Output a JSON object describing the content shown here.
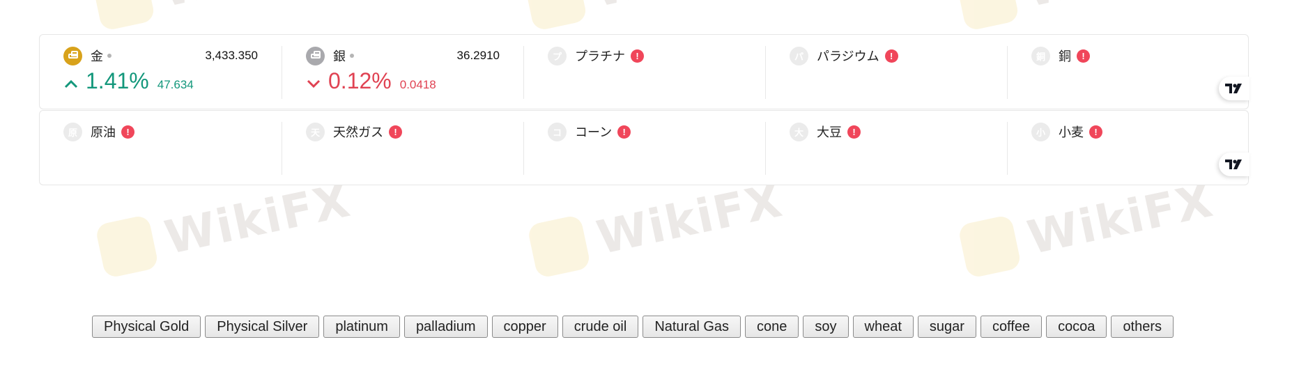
{
  "watermark": {
    "text": "WikiFX"
  },
  "tickers_row1": [
    {
      "symbol": "gold",
      "name": "金",
      "price": "3,433.350",
      "change_pct": "1.41%",
      "change_abs": "47.634",
      "direction": "up",
      "icon": "gold-bar-icon"
    },
    {
      "symbol": "silver",
      "name": "銀",
      "price": "36.2910",
      "change_pct": "0.12%",
      "change_abs": "0.0418",
      "direction": "down",
      "icon": "silver-bar-icon"
    },
    {
      "symbol": "platinum",
      "name": "プラチナ",
      "glyph": "プ",
      "status": "error"
    },
    {
      "symbol": "palladium",
      "name": "パラジウム",
      "glyph": "パ",
      "status": "error"
    },
    {
      "symbol": "copper",
      "name": "銅",
      "glyph": "銅",
      "status": "error"
    }
  ],
  "tickers_row2": [
    {
      "symbol": "crude-oil",
      "name": "原油",
      "glyph": "原",
      "status": "error"
    },
    {
      "symbol": "natural-gas",
      "name": "天然ガス",
      "glyph": "天",
      "status": "error"
    },
    {
      "symbol": "corn",
      "name": "コーン",
      "glyph": "コ",
      "status": "error"
    },
    {
      "symbol": "soybean",
      "name": "大豆",
      "glyph": "大",
      "status": "error"
    },
    {
      "symbol": "wheat",
      "name": "小麦",
      "glyph": "小",
      "status": "error"
    }
  ],
  "warn_glyph": "!",
  "colors": {
    "up": "#13977b",
    "down": "#e04252",
    "warn": "#f0465a",
    "gold": "#d8a21b",
    "silver": "#a9a9ad"
  },
  "tradingview_logo": "tradingview-logo-icon",
  "buttons": [
    "Physical Gold",
    "Physical Silver",
    "platinum",
    "palladium",
    "copper",
    "crude oil",
    "Natural Gas",
    "cone",
    "soy",
    "wheat",
    "sugar",
    "coffee",
    "cocoa",
    "others"
  ]
}
